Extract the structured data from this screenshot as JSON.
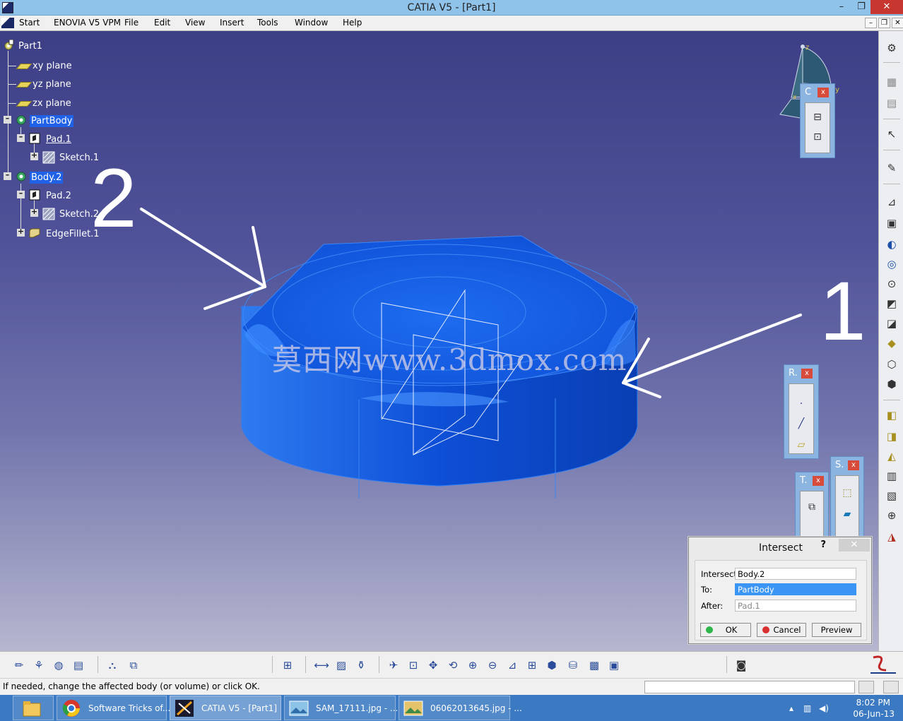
{
  "window": {
    "title": "CATIA V5 - [Part1]",
    "minimize_glyph": "–",
    "restore_glyph": "❐",
    "close_glyph": "✕"
  },
  "menu": {
    "items": [
      "Start",
      "ENOVIA V5 VPM",
      "File",
      "Edit",
      "View",
      "Insert",
      "Tools",
      "Window",
      "Help"
    ]
  },
  "tree": {
    "root": "Part1",
    "nodes": {
      "xy_plane": "xy plane",
      "yz_plane": "yz plane",
      "zx_plane": "zx plane",
      "partbody": "PartBody",
      "pad1": "Pad.1",
      "sketch1": "Sketch.1",
      "body2": "Body.2",
      "pad2": "Pad.2",
      "sketch2": "Sketch.2",
      "edgefillet1": "EdgeFillet.1"
    }
  },
  "annotations": {
    "label_1": "1",
    "label_2": "2"
  },
  "watermark": "莫西网www.3dmox.com",
  "compass": {
    "z": "z",
    "y": "y",
    "x": "x"
  },
  "floating_toolbars": {
    "c": {
      "title": "C",
      "close": "x"
    },
    "r": {
      "title": "R.",
      "close": "x"
    },
    "t": {
      "title": "T.",
      "close": "x"
    },
    "s": {
      "title": "S.",
      "close": "x"
    }
  },
  "dialog": {
    "title": "Intersect",
    "help": "?",
    "close": "✕",
    "intersect_label": "Intersect",
    "intersect_value": "Body.2",
    "to_label": "To:",
    "to_value": "PartBody",
    "after_label": "After:",
    "after_value": "Pad.1",
    "ok_label": "OK",
    "cancel_label": "Cancel",
    "preview_label": "Preview"
  },
  "status": {
    "message": "If needed, change the affected body (or volume) or click OK."
  },
  "taskbar": {
    "items": [
      "Software Tricks of...",
      "CATIA V5 - [Part1]",
      "SAM_17111.jpg - ...",
      "06062013645.jpg - ..."
    ],
    "time": "8:02 PM",
    "date": "06-Jun-13"
  },
  "colors": {
    "part_blue": "#1a63e6",
    "selection": "#1f62e8",
    "viewport_top": "#3d3f86",
    "taskbar": "#3b79c2"
  }
}
